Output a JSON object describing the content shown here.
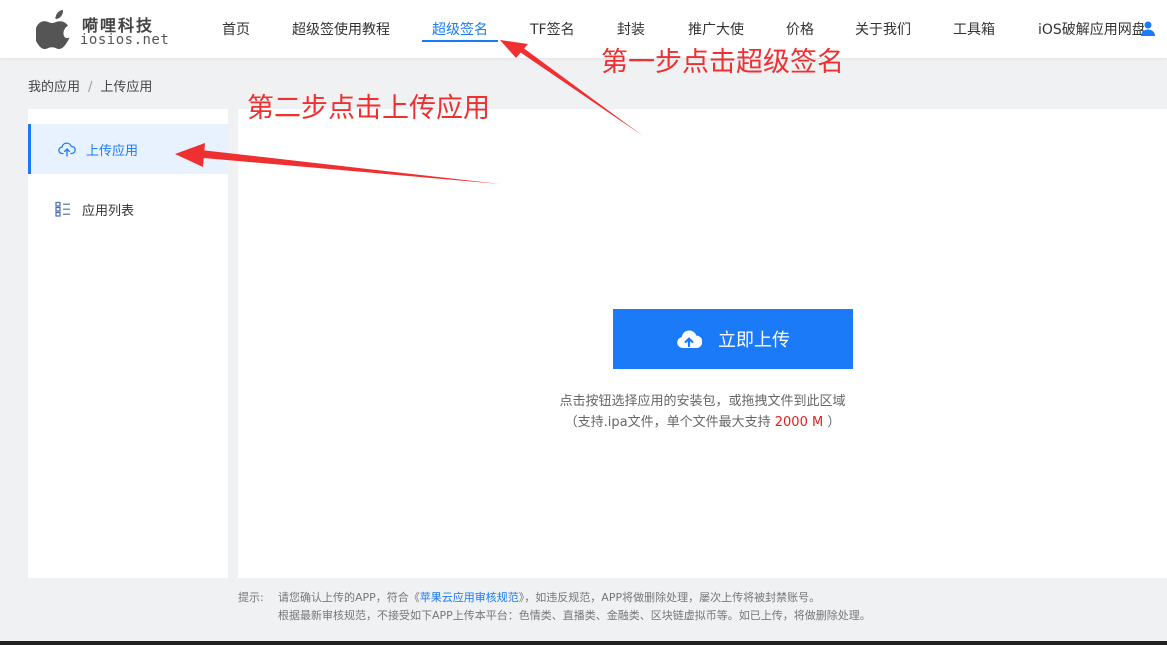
{
  "logo": {
    "name_cn": "嗬哩科技",
    "domain": "iosios.net"
  },
  "nav": {
    "items": [
      {
        "label": "首页"
      },
      {
        "label": "超级签使用教程"
      },
      {
        "label": "超级签名",
        "active": true
      },
      {
        "label": "TF签名"
      },
      {
        "label": "封装"
      },
      {
        "label": "推广大使"
      },
      {
        "label": "价格"
      },
      {
        "label": "关于我们"
      },
      {
        "label": "工具箱"
      },
      {
        "label": "iOS破解应用网盘"
      }
    ]
  },
  "breadcrumb": {
    "root": "我的应用",
    "separator": "/",
    "current": "上传应用"
  },
  "sidebar": {
    "items": [
      {
        "label": "上传应用",
        "icon": "cloud-upload-icon",
        "active": true
      },
      {
        "label": "应用列表",
        "icon": "list-icon"
      }
    ]
  },
  "main": {
    "upload_button": "立即上传",
    "hint_line1": "点击按钮选择应用的安装包，或拖拽文件到此区域",
    "hint_line2_prefix": "（支持.ipa文件，单个文件最大支持 ",
    "hint_line2_size": "2000 M",
    "hint_line2_suffix": " ）"
  },
  "tip": {
    "label": "提示:",
    "line1_prefix": "请您确认上传的APP，符合《",
    "line1_link": "苹果云应用审核规范",
    "line1_suffix": "》，如违反规范，APP将做删除处理，屡次上传将被封禁账号。",
    "line2": "根据最新审核规范，不接受如下APP上传本平台：色情类、直播类、金融类、区块链虚拟币等。如已上传，将做删除处理。"
  },
  "annotations": {
    "step1": "第一步点击超级签名",
    "step2": "第二步点击上传应用",
    "color": "#f03030"
  },
  "colors": {
    "accent": "#1a7af8",
    "highlight": "#e02020"
  }
}
